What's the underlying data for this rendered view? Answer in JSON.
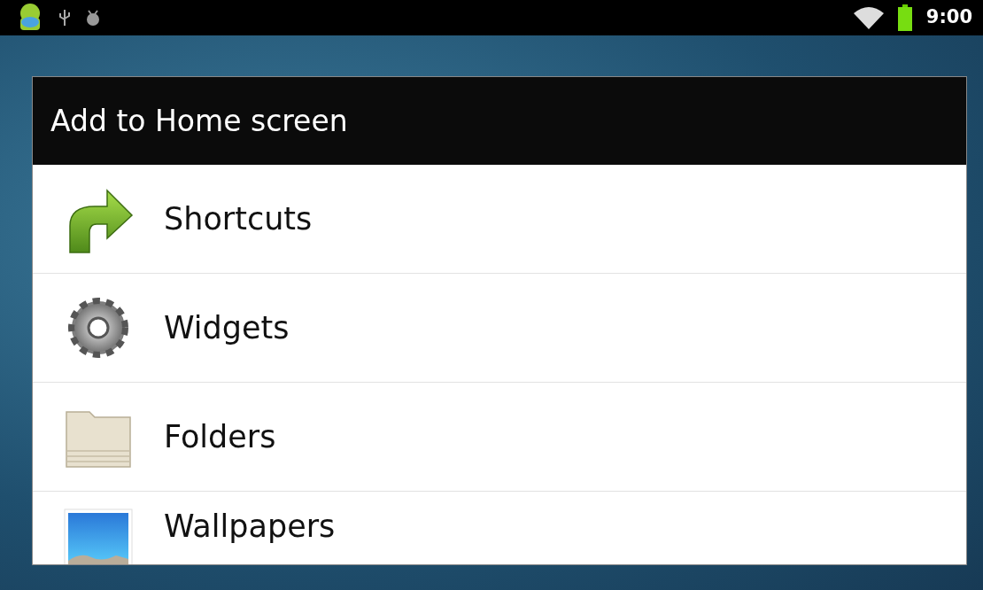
{
  "status_bar": {
    "time": "9:00"
  },
  "dialog": {
    "title": "Add to Home screen",
    "items": [
      {
        "label": "Shortcuts",
        "kind": "shortcut"
      },
      {
        "label": "Widgets",
        "kind": "widget"
      },
      {
        "label": "Folders",
        "kind": "folder"
      },
      {
        "label": "Wallpapers",
        "kind": "wallpaper"
      }
    ]
  }
}
